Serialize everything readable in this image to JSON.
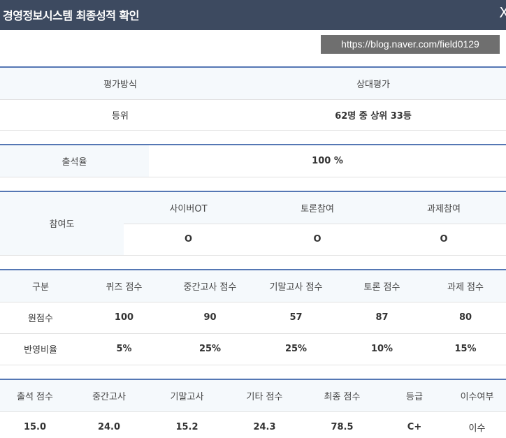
{
  "window": {
    "title": "경영정보시스템 최종성적 확인",
    "close_glyph": "X"
  },
  "watermark": "https://blog.naver.com/field0129",
  "evaluation": {
    "method_label": "평가방식",
    "method_value": "상대평가",
    "rank_label": "등위",
    "rank_value": "62명 중 상위 33등"
  },
  "attendance": {
    "label": "출석율",
    "value": "100 %"
  },
  "participation": {
    "label": "참여도",
    "columns": [
      "사이버OT",
      "토론참여",
      "과제참여"
    ],
    "values": [
      "O",
      "O",
      "O"
    ]
  },
  "scores": {
    "headers": [
      "구분",
      "퀴즈 점수",
      "중간고사 점수",
      "기말고사 점수",
      "토론 점수",
      "과제 점수"
    ],
    "raw_label": "원점수",
    "raw_values": [
      "100",
      "90",
      "57",
      "87",
      "80"
    ],
    "weight_label": "반영비율",
    "weight_values": [
      "5%",
      "25%",
      "25%",
      "10%",
      "15%"
    ]
  },
  "final": {
    "headers": [
      "출석 점수",
      "중간고사",
      "기말고사",
      "기타 점수",
      "최종 점수",
      "등급",
      "이수여부"
    ],
    "values": [
      "15.0",
      "24.0",
      "15.2",
      "24.3",
      "78.5",
      "C+",
      "이수"
    ]
  },
  "colors": {
    "title_bar": "#3d4a60",
    "table_border": "#5577b4",
    "header_bg": "#f5f9fc"
  }
}
